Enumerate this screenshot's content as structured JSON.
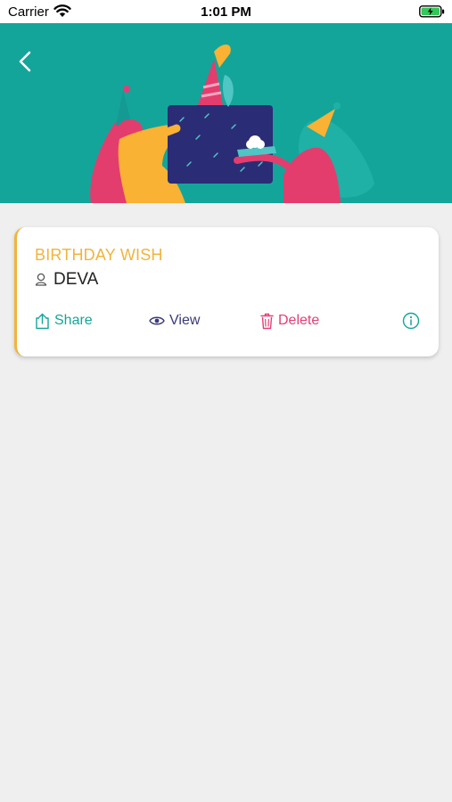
{
  "status_bar": {
    "carrier": "Carrier",
    "time": "1:01 PM"
  },
  "card": {
    "title": "BIRTHDAY WISH",
    "name": "DEVA",
    "accent_color": "#f1b43c"
  },
  "actions": {
    "share_label": "Share",
    "view_label": "View",
    "delete_label": "Delete"
  },
  "colors": {
    "banner": "#14a59a",
    "share": "#14a59a",
    "view": "#3b3a7a",
    "delete": "#e33d77",
    "background": "#efefef"
  },
  "icons": [
    "wifi-icon",
    "battery-icon",
    "back-arrow-icon",
    "person-icon",
    "share-icon",
    "eye-icon",
    "trash-icon",
    "info-icon"
  ]
}
